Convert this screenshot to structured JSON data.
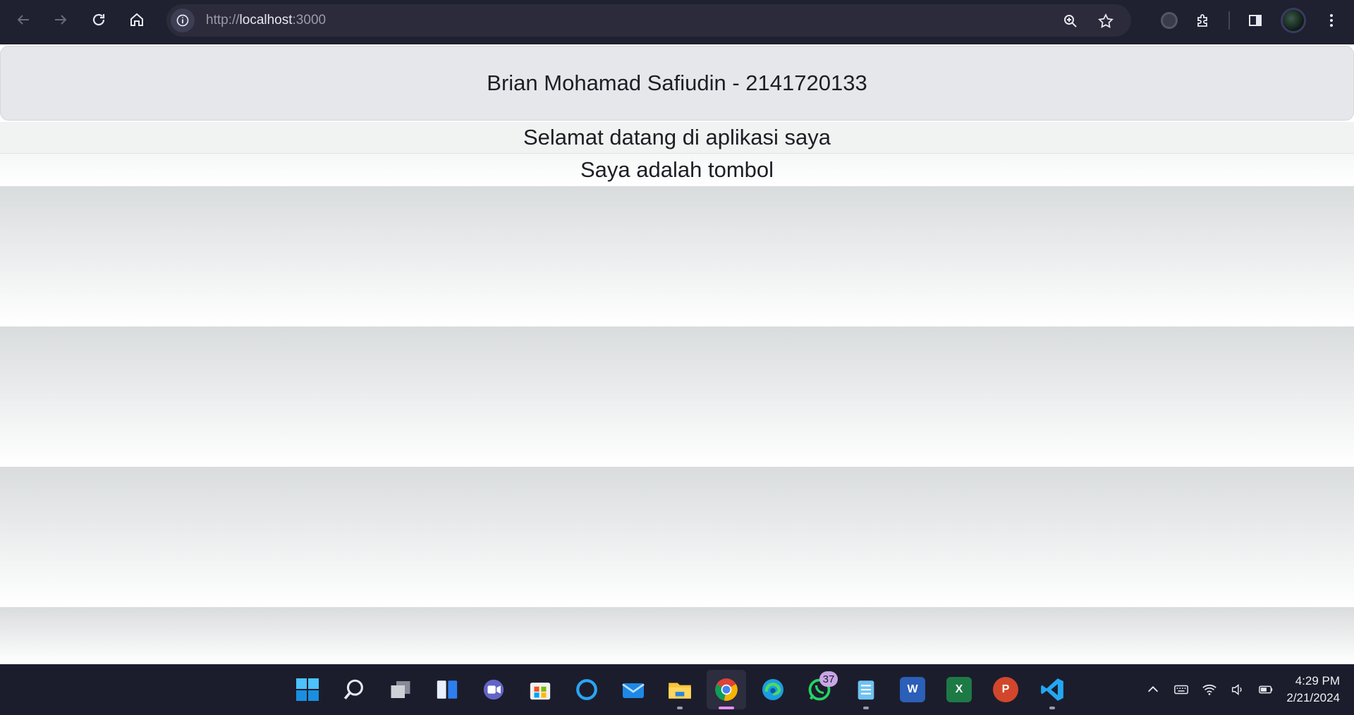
{
  "browser": {
    "url_scheme": "http://",
    "url_host": "localhost",
    "url_port": ":3000"
  },
  "page": {
    "header_title": "Brian Mohamad Safiudin - 2141720133",
    "welcome_text": "Selamat datang di aplikasi saya",
    "button_text": "Saya adalah tombol"
  },
  "taskbar": {
    "whatsapp_badge": "37",
    "time": "4:29 PM",
    "date": "2/21/2024"
  },
  "icons": {
    "apps": [
      "windows-start-icon",
      "search-icon",
      "task-view-icon",
      "widgets-icon",
      "teams-icon",
      "store-icon",
      "cortana-icon",
      "mail-icon",
      "file-explorer-icon",
      "chrome-icon",
      "edge-icon",
      "whatsapp-icon",
      "notepad-icon",
      "word-icon",
      "excel-icon",
      "powerpoint-icon",
      "vscode-icon"
    ]
  }
}
